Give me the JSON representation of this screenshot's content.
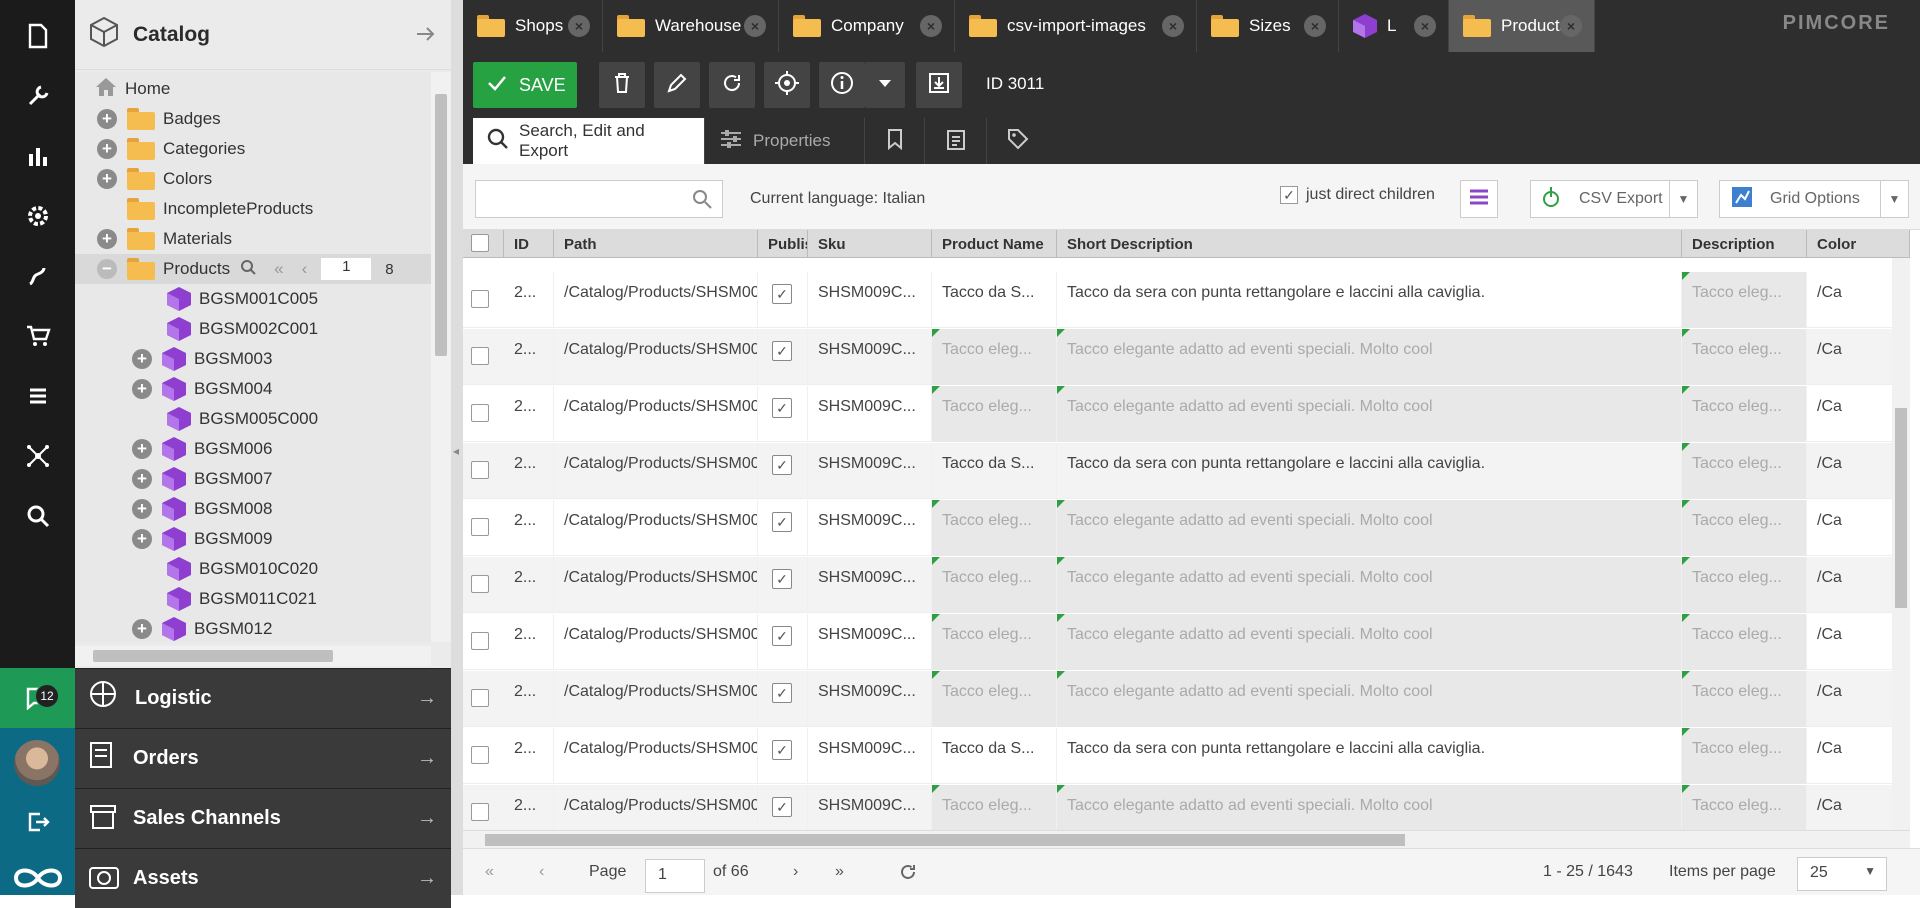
{
  "app": {
    "logo": "PIMCORE"
  },
  "leftbar": {
    "chat_badge": "12"
  },
  "tree": {
    "title": "Catalog",
    "nodes": [
      {
        "label": "Home"
      },
      {
        "label": "Badges"
      },
      {
        "label": "Categories"
      },
      {
        "label": "Colors"
      },
      {
        "label": "IncompleteProducts"
      },
      {
        "label": "Materials"
      },
      {
        "label": "Products",
        "pager_current": "1",
        "pager_total": "8"
      },
      {
        "label": "BGSM001C005"
      },
      {
        "label": "BGSM002C001"
      },
      {
        "label": "BGSM003"
      },
      {
        "label": "BGSM004"
      },
      {
        "label": "BGSM005C000"
      },
      {
        "label": "BGSM006"
      },
      {
        "label": "BGSM007"
      },
      {
        "label": "BGSM008"
      },
      {
        "label": "BGSM009"
      },
      {
        "label": "BGSM010C020"
      },
      {
        "label": "BGSM011C021"
      },
      {
        "label": "BGSM012"
      }
    ]
  },
  "accordion": [
    {
      "label": "Logistic"
    },
    {
      "label": "Orders"
    },
    {
      "label": "Sales Channels"
    },
    {
      "label": "Assets"
    }
  ],
  "tabs": [
    {
      "label": "Shops"
    },
    {
      "label": "Warehouse"
    },
    {
      "label": "Company"
    },
    {
      "label": "csv-import-images"
    },
    {
      "label": "Sizes"
    },
    {
      "label": "L"
    },
    {
      "label": "Products"
    }
  ],
  "toolbar": {
    "save_label": "SAVE",
    "id_label": "ID 3011"
  },
  "subtabs": {
    "search": "Search, Edit and Export",
    "properties": "Properties"
  },
  "filter": {
    "search_placeholder": "",
    "language": "Current language: Italian",
    "direct_children": "just direct children",
    "csv_export": "CSV Export",
    "grid_options": "Grid Options"
  },
  "grid": {
    "columns": {
      "id": "ID",
      "path": "Path",
      "published": "Publis",
      "sku": "Sku",
      "name": "Product Name",
      "short": "Short Description",
      "desc": "Description",
      "color": "Color"
    },
    "rows": [
      {
        "id": "2...",
        "path": "/Catalog/Products/SHSM00...",
        "sku": "SHSM009C...",
        "name": "Tacco da S...",
        "short": "Tacco da sera con punta rettangolare e laccini alla caviglia.",
        "inherited": false,
        "desc": "Tacco eleg...",
        "color": "/Ca"
      },
      {
        "id": "2...",
        "path": "/Catalog/Products/SHSM00...",
        "sku": "SHSM009C...",
        "name": "Tacco eleg...",
        "short": "Tacco elegante adatto ad eventi speciali. Molto cool",
        "inherited": true,
        "desc": "Tacco eleg...",
        "color": "/Ca"
      },
      {
        "id": "2...",
        "path": "/Catalog/Products/SHSM00...",
        "sku": "SHSM009C...",
        "name": "Tacco eleg...",
        "short": "Tacco elegante adatto ad eventi speciali. Molto cool",
        "inherited": true,
        "desc": "Tacco eleg...",
        "color": "/Ca"
      },
      {
        "id": "2...",
        "path": "/Catalog/Products/SHSM00...",
        "sku": "SHSM009C...",
        "name": "Tacco da S...",
        "short": "Tacco da sera con punta rettangolare e laccini alla caviglia.",
        "inherited": false,
        "desc": "Tacco eleg...",
        "color": "/Ca"
      },
      {
        "id": "2...",
        "path": "/Catalog/Products/SHSM00...",
        "sku": "SHSM009C...",
        "name": "Tacco eleg...",
        "short": "Tacco elegante adatto ad eventi speciali. Molto cool",
        "inherited": true,
        "desc": "Tacco eleg...",
        "color": "/Ca"
      },
      {
        "id": "2...",
        "path": "/Catalog/Products/SHSM00...",
        "sku": "SHSM009C...",
        "name": "Tacco eleg...",
        "short": "Tacco elegante adatto ad eventi speciali. Molto cool",
        "inherited": true,
        "desc": "Tacco eleg...",
        "color": "/Ca"
      },
      {
        "id": "2...",
        "path": "/Catalog/Products/SHSM00...",
        "sku": "SHSM009C...",
        "name": "Tacco eleg...",
        "short": "Tacco elegante adatto ad eventi speciali. Molto cool",
        "inherited": true,
        "desc": "Tacco eleg...",
        "color": "/Ca"
      },
      {
        "id": "2...",
        "path": "/Catalog/Products/SHSM00...",
        "sku": "SHSM009C...",
        "name": "Tacco eleg...",
        "short": "Tacco elegante adatto ad eventi speciali. Molto cool",
        "inherited": true,
        "desc": "Tacco eleg...",
        "color": "/Ca"
      },
      {
        "id": "2...",
        "path": "/Catalog/Products/SHSM00...",
        "sku": "SHSM009C...",
        "name": "Tacco da S...",
        "short": "Tacco da sera con punta rettangolare e laccini alla caviglia.",
        "inherited": false,
        "desc": "Tacco eleg...",
        "color": "/Ca"
      },
      {
        "id": "2...",
        "path": "/Catalog/Products/SHSM00...",
        "sku": "SHSM009C...",
        "name": "Tacco eleg...",
        "short": "Tacco elegante adatto ad eventi speciali. Molto cool",
        "inherited": true,
        "desc": "Tacco eleg...",
        "color": "/Ca"
      }
    ]
  },
  "pager": {
    "page_label": "Page",
    "page": "1",
    "of": "of 66",
    "range": "1 - 25 / 1643",
    "ipp_label": "Items per page",
    "ipp": "25"
  }
}
